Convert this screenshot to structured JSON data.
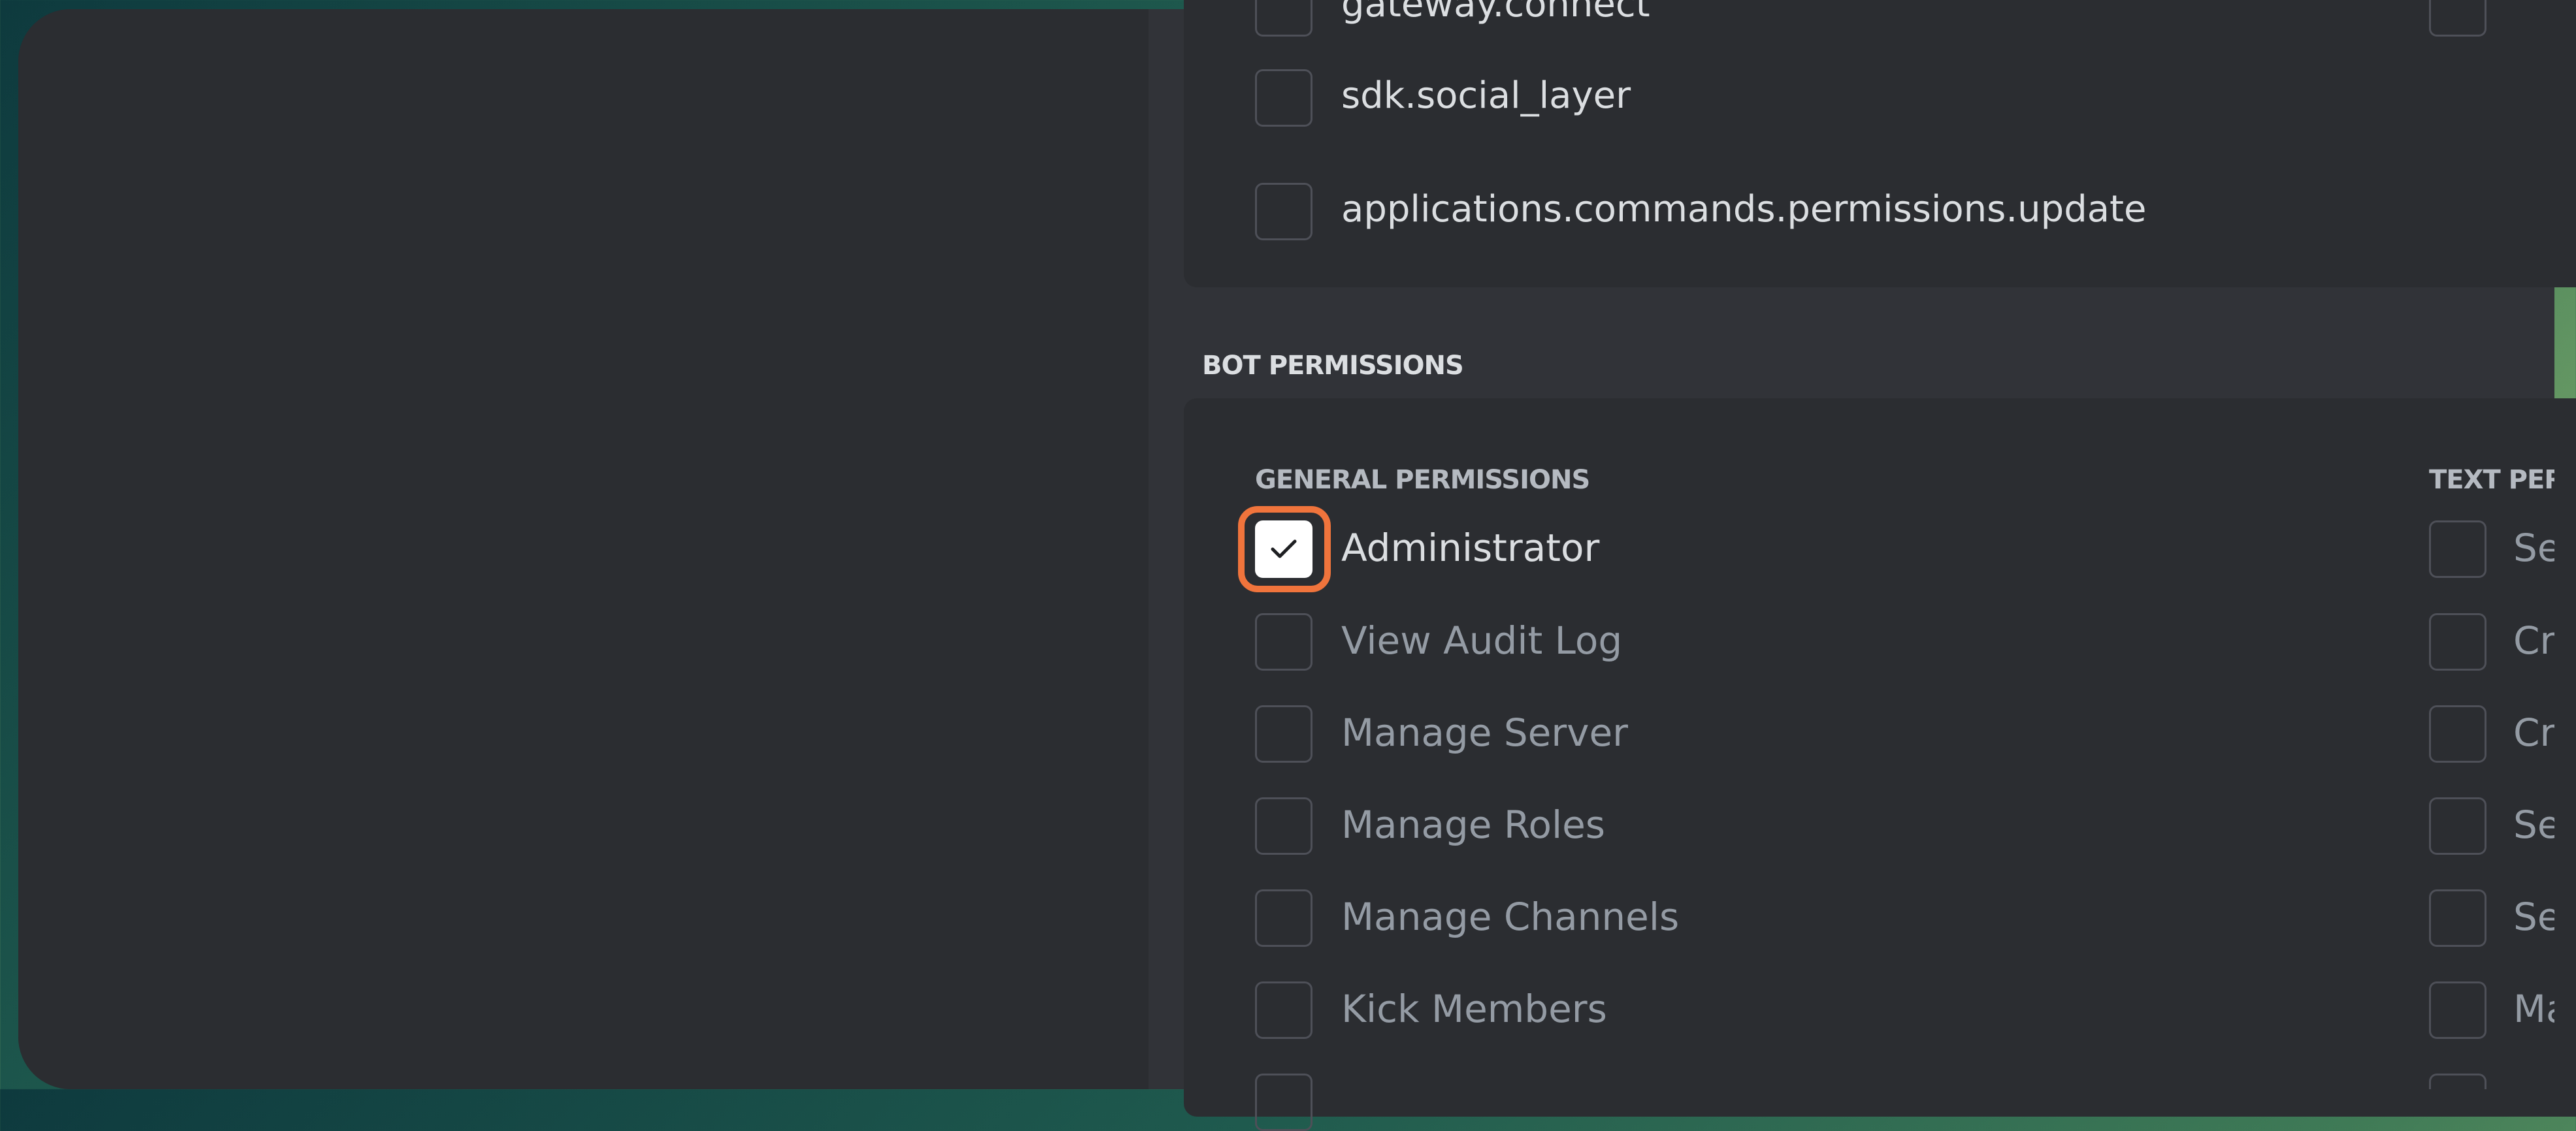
{
  "scopes": [
    {
      "label": "gateway.connect",
      "checked": false
    },
    {
      "label": "sdk.social_layer",
      "checked": false
    },
    {
      "label": "applications.commands.permissions.update",
      "checked": false
    }
  ],
  "bot_permissions": {
    "heading": "BOT PERMISSIONS",
    "general_heading": "GENERAL PERMISSIONS",
    "text_heading": "TEXT PERMISSIONS",
    "general": [
      {
        "label": "Administrator",
        "checked": true
      },
      {
        "label": "View Audit Log",
        "checked": false
      },
      {
        "label": "Manage Server",
        "checked": false
      },
      {
        "label": "Manage Roles",
        "checked": false
      },
      {
        "label": "Manage Channels",
        "checked": false
      },
      {
        "label": "Kick Members",
        "checked": false
      }
    ],
    "text": [
      {
        "label": "Send Messages",
        "checked": false
      },
      {
        "label": "Create Public Threads",
        "checked": false
      },
      {
        "label": "Create Private Threads",
        "checked": false
      },
      {
        "label": "Send Messages in Threads",
        "checked": false
      },
      {
        "label": "Send TTS Messages",
        "checked": false
      },
      {
        "label": "Manage Messages",
        "checked": false
      }
    ]
  },
  "colors": {
    "accent_highlight": "#f0743c",
    "page_background": "#313338",
    "card_background": "#2b2d31"
  }
}
